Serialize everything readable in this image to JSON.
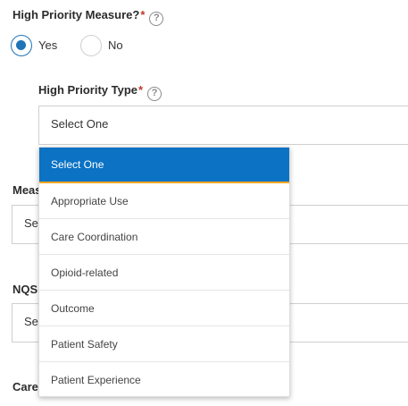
{
  "high_priority_measure": {
    "label": "High Priority Measure?",
    "required_mark": "*",
    "help_icon": "question-circle-icon",
    "options": [
      {
        "label": "Yes",
        "selected": true
      },
      {
        "label": "No",
        "selected": false
      }
    ]
  },
  "high_priority_type": {
    "label": "High Priority Type",
    "required_mark": "*",
    "help_icon": "question-circle-icon",
    "value": "Select One",
    "dropdown_options": [
      "Select One",
      "Appropriate Use",
      "Care Coordination",
      "Opioid-related",
      "Outcome",
      "Patient Safety",
      "Patient Experience"
    ],
    "highlighted_option": "Select One"
  },
  "measure_field": {
    "label_visible": "Meas",
    "value_visible": "Se"
  },
  "nqs_field": {
    "label_visible": "NQS",
    "value_visible": "Se"
  },
  "care_field": {
    "label_visible": "Care"
  },
  "colors": {
    "accent": "#0b72c4",
    "highlight_underline": "#f5a623",
    "required": "#c0392b"
  }
}
